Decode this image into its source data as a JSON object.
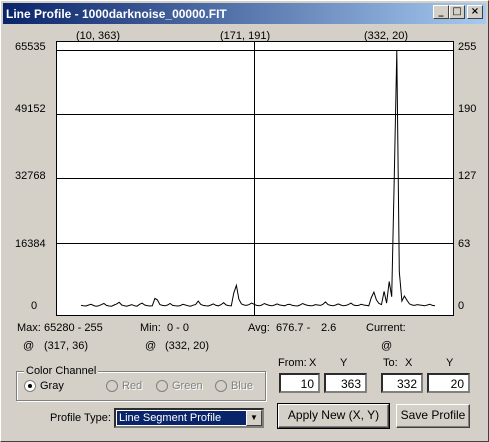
{
  "window": {
    "title": "Line Profile - 1000darknoise_00000.FIT",
    "minimize_glyph": "_",
    "maximize_glyph": "□",
    "close_glyph": "×"
  },
  "chart_data": {
    "type": "line",
    "top_labels": [
      "(10, 363)",
      "(171, 191)",
      "(332, 20)"
    ],
    "y_left_ticks": [
      "65535",
      "49152",
      "32768",
      "16384",
      "0"
    ],
    "y_right_ticks": [
      "255",
      "190",
      "127",
      "63",
      "0"
    ],
    "ylim": [
      0,
      65535
    ],
    "grid": true,
    "series": [
      {
        "values": [
          400,
          300,
          250,
          500,
          700,
          350,
          200,
          300,
          600,
          900,
          400,
          250,
          200,
          500,
          800,
          1200,
          500,
          300,
          200,
          400,
          600,
          300,
          200,
          700,
          1000,
          500,
          350,
          250,
          300,
          2200,
          1800,
          600,
          400,
          300,
          500,
          900,
          400,
          300,
          250,
          350,
          700,
          500,
          300,
          200,
          450,
          600,
          1500,
          700,
          400,
          300,
          250,
          500,
          800,
          400,
          300,
          600,
          1100,
          500,
          350,
          300,
          3600,
          5500,
          2000,
          800,
          500,
          400,
          600,
          1000,
          700,
          400,
          300,
          500,
          900,
          600,
          400,
          300,
          500,
          800,
          500,
          400,
          300,
          600,
          700,
          400,
          300,
          250,
          500,
          900,
          600,
          400,
          300,
          350,
          600,
          500,
          400,
          700,
          1300,
          600,
          400,
          300,
          500,
          800,
          500,
          300,
          400,
          600,
          1000,
          500,
          350,
          400,
          700,
          500,
          400,
          300,
          2400,
          3800,
          1800,
          900,
          600,
          4000,
          1000,
          6500,
          2600,
          33500,
          65280,
          9000,
          1500,
          2800,
          1700,
          800,
          500,
          400,
          600,
          500,
          400,
          300,
          500,
          700,
          400,
          300
        ]
      }
    ]
  },
  "stats": {
    "max_label": "Max:",
    "max_value": "65280 - 255",
    "max_at": "@",
    "max_coord": "(317, 36)",
    "min_label": "Min:",
    "min_value": "0 - 0",
    "min_at": "@",
    "min_coord": "(332, 20)",
    "avg_label": "Avg:",
    "avg_value": "676.7 -",
    "avg_value2": "2.6",
    "current_label": "Current:",
    "current_at": "@"
  },
  "color_channel": {
    "title": "Color Channel",
    "options": [
      "Gray",
      "Red",
      "Green",
      "Blue"
    ],
    "selected": "Gray"
  },
  "coords": {
    "from_label": "From:",
    "to_label": "To:",
    "x_label": "X",
    "y_label": "Y",
    "from_x": "10",
    "from_y": "363",
    "to_x": "332",
    "to_y": "20"
  },
  "profile": {
    "label": "Profile Type:",
    "value": "Line Segment Profile"
  },
  "buttons": {
    "apply": "Apply New (X, Y)",
    "save": "Save Profile"
  }
}
